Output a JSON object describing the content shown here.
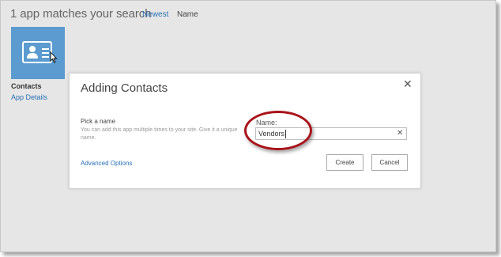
{
  "results": {
    "heading": "1 app matches your search",
    "sort_newest": "Newest",
    "sort_name": "Name"
  },
  "app": {
    "name": "Contacts",
    "details_link": "App Details",
    "tile_color": "#5b9bd0"
  },
  "dialog": {
    "title": "Adding Contacts",
    "close_icon": "close-icon",
    "pick_label": "Pick a name",
    "pick_help": "You can add this app multiple times to your site. Give it a unique name.",
    "name_label": "Name:",
    "name_value": "Vendors",
    "clear_icon": "clear-icon",
    "advanced_link": "Advanced Options",
    "create_label": "Create",
    "cancel_label": "Cancel",
    "highlight_color": "#a8141a"
  }
}
